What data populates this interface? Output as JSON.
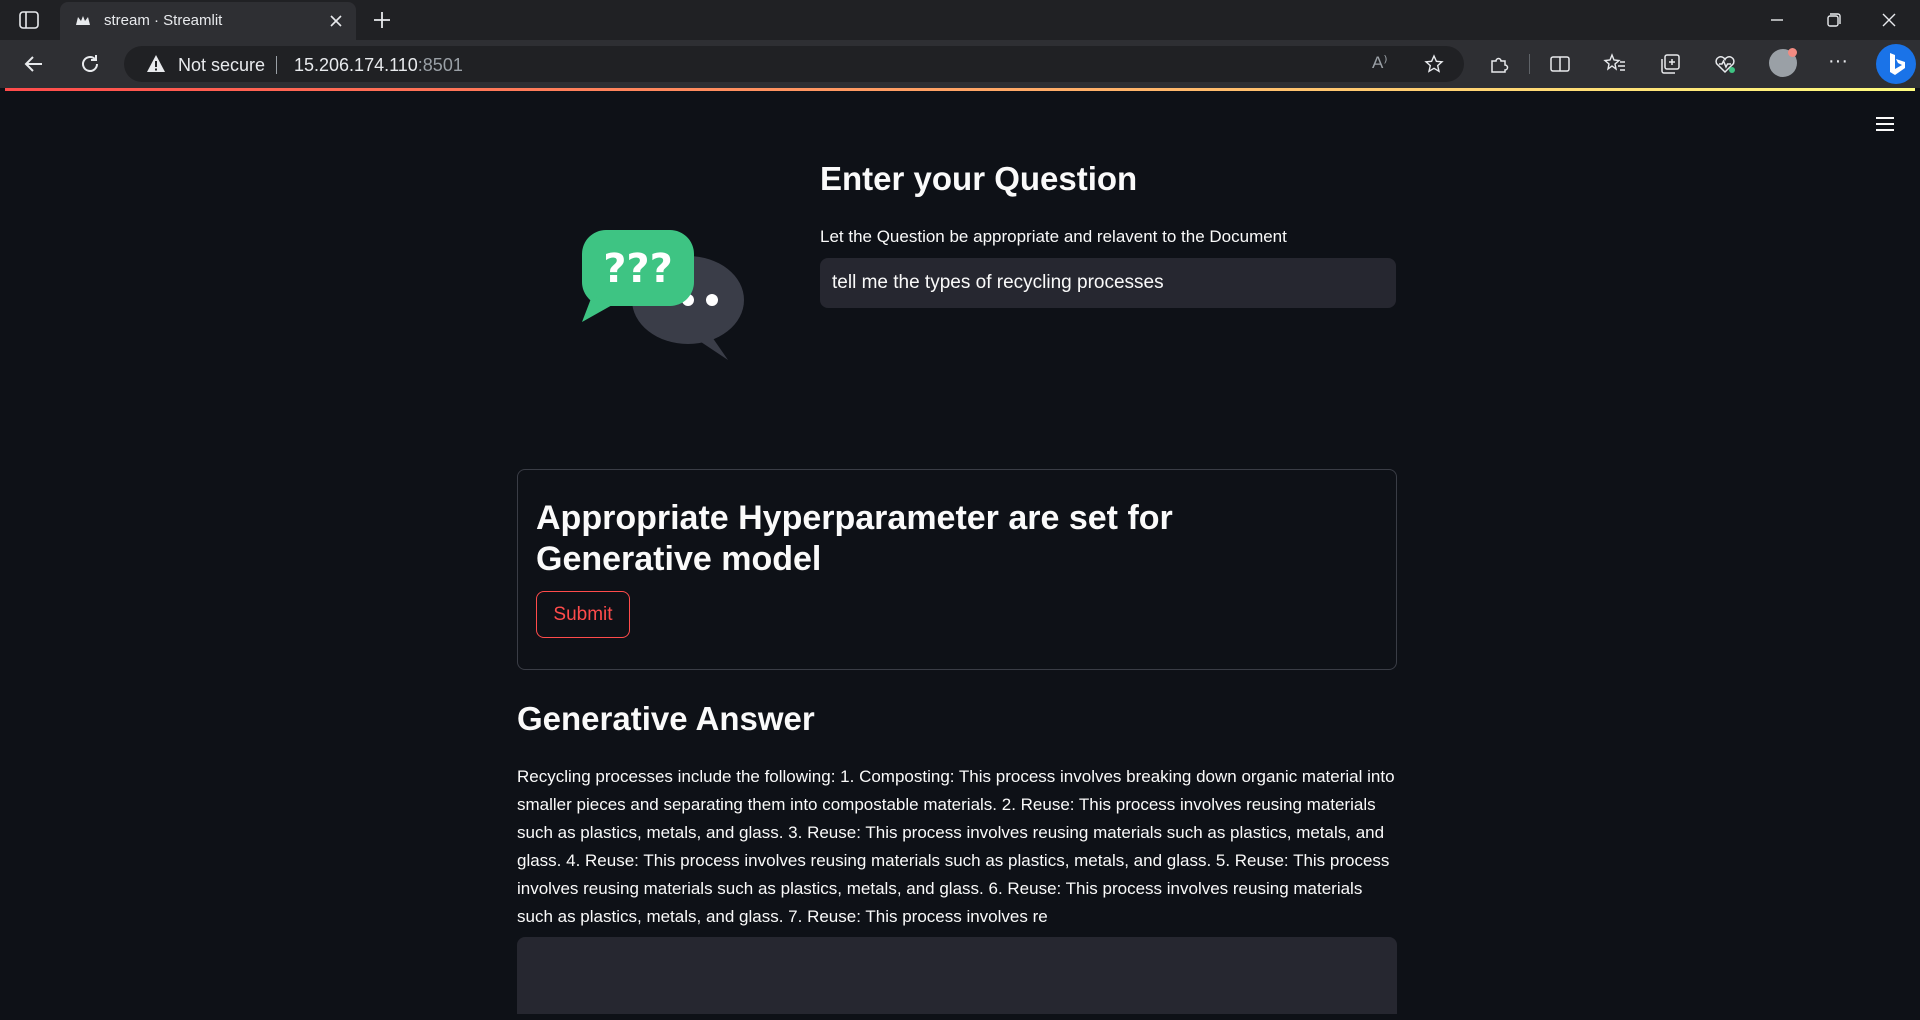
{
  "browser": {
    "tab_title": "stream · Streamlit",
    "security_label": "Not secure",
    "url_host": "15.206.174.110",
    "url_port": ":8501",
    "read_aloud_glyph": "A⁾"
  },
  "page": {
    "question_title": "Enter your Question",
    "question_label": "Let the Question be appropriate and relavent to the Document",
    "question_value": "tell me the types of recycling processes",
    "form_title": "Appropriate Hyperparameter are set for Generative model",
    "submit_label": "Submit",
    "answer_title": "Generative Answer",
    "answer_text": "Recycling processes include the following: 1. Composting: This process involves breaking down organic material into smaller pieces and separating them into compostable materials. 2. Reuse: This process involves reusing materials such as plastics, metals, and glass. 3. Reuse: This process involves reusing materials such as plastics, metals, and glass. 4. Reuse: This process involves reusing materials such as plastics, metals, and glass. 5. Reuse: This process involves reusing materials such as plastics, metals, and glass. 6. Reuse: This process involves reusing materials such as plastics, metals, and glass. 7. Reuse: This process involves re"
  },
  "colors": {
    "accent": "#ff4b4b",
    "background": "#0e1117",
    "input_bg": "#262730",
    "bubble_green": "#3ec483",
    "bubble_gray": "#3a3d48"
  },
  "icons": {
    "tab_switch": "tab-actions-icon",
    "favicon": "streamlit-crown-icon",
    "close": "close-icon",
    "new_tab": "plus-icon",
    "back": "arrow-left-icon",
    "reload": "reload-icon",
    "warning": "warning-icon",
    "favorite": "star-icon",
    "extensions": "puzzle-icon",
    "split_screen": "split-screen-icon",
    "favorites": "favorites-list-icon",
    "collections": "collections-icon",
    "health": "browser-essentials-icon",
    "more": "more-icon",
    "bing": "bing-chat-icon",
    "menu": "hamburger-menu-icon",
    "question_image": "question-chat-bubbles-icon"
  }
}
